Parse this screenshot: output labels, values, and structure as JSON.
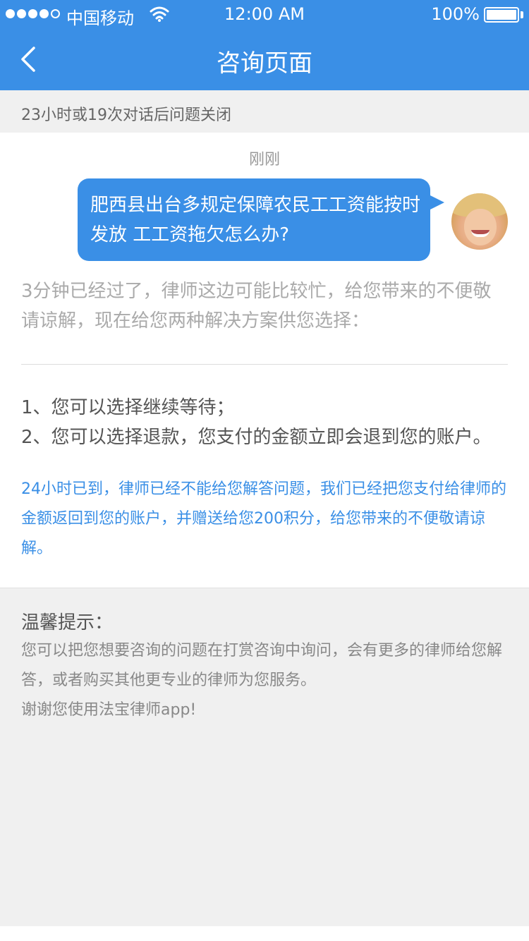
{
  "status_bar": {
    "carrier": "中国移动",
    "time": "12:00 AM",
    "battery": "100%"
  },
  "nav": {
    "title": "咨询页面"
  },
  "notice": {
    "text": "23小时或19次对话后问题关闭"
  },
  "chat": {
    "timestamp": "刚刚",
    "user_message": "肥西县出台多规定保障农民工工资能按时发放 工工资拖欠怎么办?",
    "auto_reply": "3分钟已经过了，律师这边可能比较忙，给您带来的不便敬请谅解，现在给您两种解决方案供您选择：",
    "options": [
      "1、您可以选择继续等待；",
      "2、您可以选择退款，您支付的金额立即会退到您的账户。"
    ],
    "refund_message": "24小时已到，律师已经不能给您解答问题，我们已经把您支付给律师的金额返回到您的账户，并赠送给您200积分，给您带来的不便敬请谅解。"
  },
  "tips": {
    "title": "温馨提示：",
    "lines": [
      "您可以把您想要咨询的问题在打赏咨询中询问，会有更多的律师给您解答，或者购买其他更专业的律师为您服务。",
      "谢谢您使用法宝律师app!"
    ]
  },
  "colors": {
    "primary": "#3a8fe6",
    "background_gray": "#f0f0f0"
  }
}
